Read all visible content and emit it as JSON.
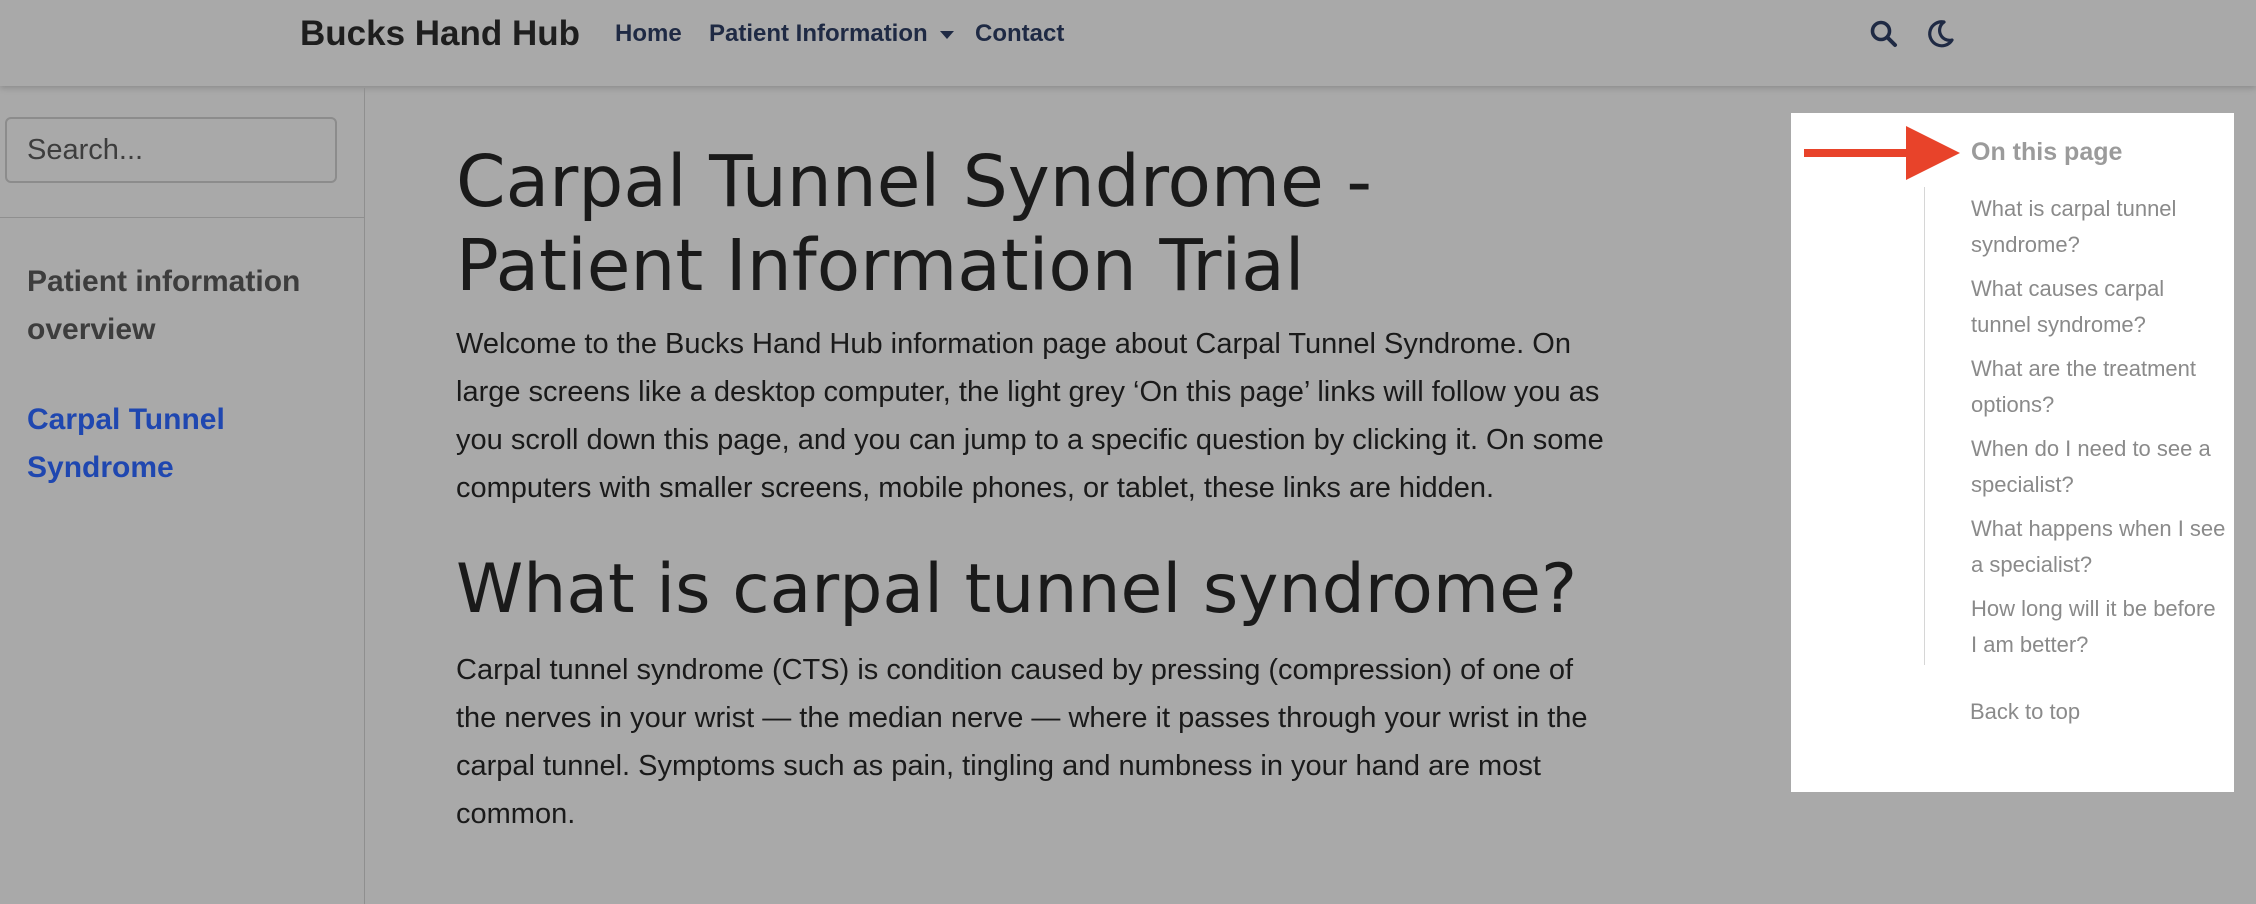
{
  "navbar": {
    "brand": "Bucks Hand Hub",
    "links": [
      "Home",
      "Patient Information",
      "Contact"
    ],
    "icons": [
      "search-icon",
      "moon-icon"
    ]
  },
  "sidebar": {
    "search_placeholder": "Search...",
    "items": [
      {
        "label": "Patient information overview",
        "active": false
      },
      {
        "label": "Carpal Tunnel Syndrome",
        "active": true
      }
    ]
  },
  "main": {
    "title": "Carpal Tunnel Syndrome - Patient Information Trial",
    "intro": "Welcome to the Bucks Hand Hub information page about Carpal Tunnel Syndrome. On large screens like a desktop computer, the light grey ‘On this page’ links will follow you as you scroll down this page, and you can jump to a specific question by clicking it. On some computers with smaller screens, mobile phones, or tablet, these links are hidden.",
    "section_heading": "What is carpal tunnel syndrome?",
    "section_text": "Carpal tunnel syndrome (CTS) is condition caused by pressing (compression) of one of the nerves in your wrist — the median nerve — where it passes through your wrist in the carpal tunnel. Symptoms such as pain, tingling and numbness in your hand are most common."
  },
  "toc": {
    "title": "On this page",
    "items": [
      "What is carpal tunnel syndrome?",
      "What causes carpal tunnel syndrome?",
      "What are the treatment options?",
      "When do I need to see a specialist?",
      "What happens when I see a specialist?",
      "How long will it be before I am better?"
    ],
    "back_to_top": "Back to top"
  },
  "colors": {
    "background": "#a9a9a9",
    "active_link": "#1f47b0",
    "arrow": "#e8432a",
    "toc_panel": "#ffffff"
  }
}
